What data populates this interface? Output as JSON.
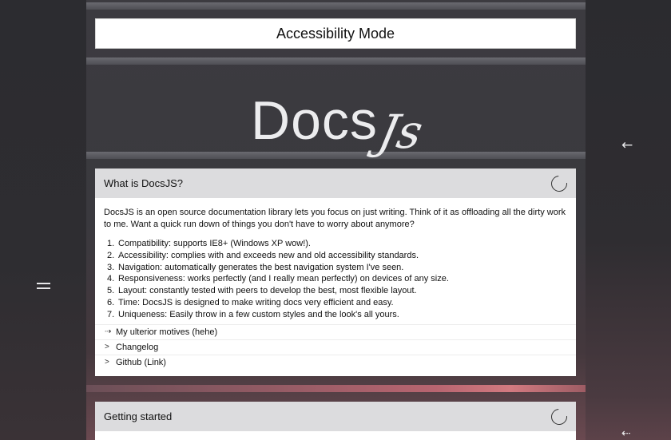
{
  "accessibility": {
    "label": "Accessibility Mode"
  },
  "logo": {
    "docs": "Docs",
    "js": "Js"
  },
  "intro_card": {
    "title": "What is DocsJS?",
    "description": "DocsJS is an open source documentation library lets you focus on just writing. Think of it as offloading all the dirty work to me. Want a quick run down of things you don't have to worry about anymore?",
    "features": [
      {
        "num": "1.",
        "text": "Compatibility: supports IE8+ (Windows XP wow!)."
      },
      {
        "num": "2.",
        "text": "Accessibility: complies with and exceeds new and old accessibility standards."
      },
      {
        "num": "3.",
        "text": "Navigation: automatically generates the best navigation system I've seen."
      },
      {
        "num": "4.",
        "text": "Responsiveness: works perfectly (and I really mean perfectly) on devices of any size."
      },
      {
        "num": "5.",
        "text": "Layout: constantly tested with peers to develop the best, most flexible layout."
      },
      {
        "num": "6.",
        "text": "Time: DocsJS is designed to make writing docs very efficient and easy."
      },
      {
        "num": "7.",
        "text": "Uniqueness: Easily throw in a few custom styles and the look's all yours."
      }
    ],
    "toggles": [
      {
        "arrow": "⇢",
        "label": "My ulterior motives (hehe)"
      },
      {
        "arrow": ">",
        "label": "Changelog"
      },
      {
        "arrow": ">",
        "label": "Github (Link)"
      }
    ]
  },
  "second_card": {
    "title": "Getting started"
  },
  "nav": {
    "menu_icon": "menu-icon",
    "back_icon": "←",
    "small_icon": "⇠"
  }
}
